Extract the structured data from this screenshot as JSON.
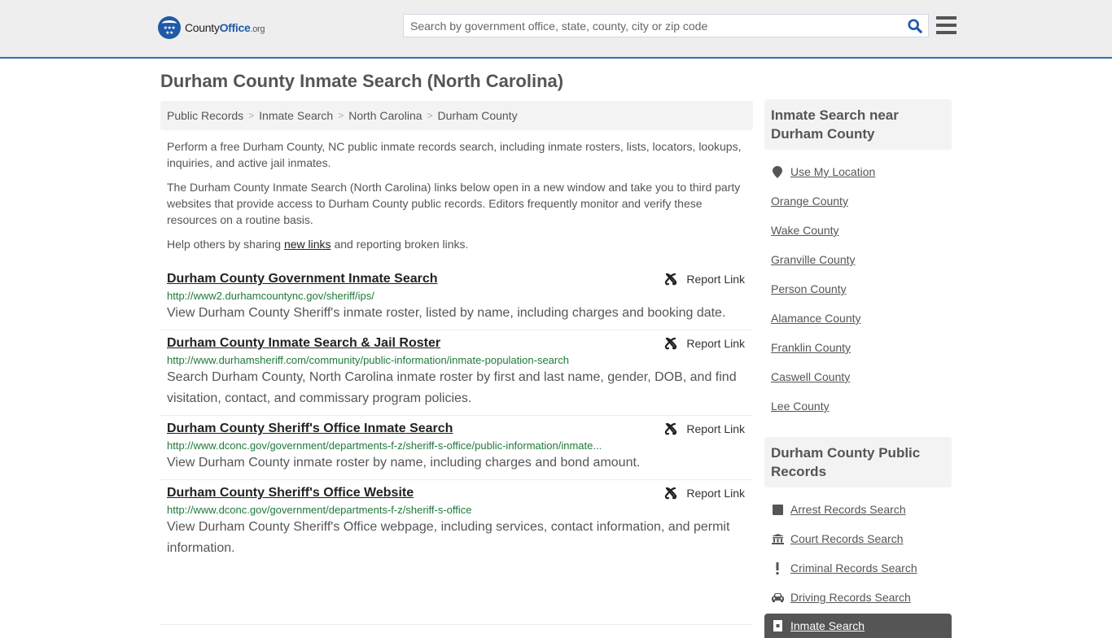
{
  "header": {
    "logo": {
      "part1": "County",
      "part2": "Office",
      "part3": ".org"
    },
    "search_placeholder": "Search by government office, state, county, city or zip code",
    "search_value": "",
    "brand_color": "#1f5aa6"
  },
  "page_title": "Durham County Inmate Search (North Carolina)",
  "breadcrumb": [
    "Public Records",
    "Inmate Search",
    "North Carolina",
    "Durham County"
  ],
  "intro": {
    "p1": "Perform a free Durham County, NC public inmate records search, including inmate rosters, lists, locators, lookups, inquiries, and active jail inmates.",
    "p2": "The Durham County Inmate Search (North Carolina) links below open in a new window and take you to third party websites that provide access to Durham County public records. Editors frequently monitor and verify these resources on a routine basis.",
    "p3_before": "Help others by sharing ",
    "p3_link": "new links",
    "p3_after": " and reporting broken links."
  },
  "report_label": "Report Link",
  "results": [
    {
      "title": "Durham County Government Inmate Search",
      "url": "http://www2.durhamcountync.gov/sheriff/ips/",
      "desc": "View Durham County Sheriff's inmate roster, listed by name, including charges and booking date."
    },
    {
      "title": "Durham County Inmate Search & Jail Roster",
      "url": "http://www.durhamsheriff.com/community/public-information/inmate-population-search",
      "desc": "Search Durham County, North Carolina inmate roster by first and last name, gender, DOB, and find visitation, contact, and commissary program policies."
    },
    {
      "title": "Durham County Sheriff's Office Inmate Search",
      "url": "http://www.dconc.gov/government/departments-f-z/sheriff-s-office/public-information/inmate...",
      "desc": "View Durham County inmate roster by name, including charges and bond amount."
    },
    {
      "title": "Durham County Sheriff's Office Website",
      "url": "http://www.dconc.gov/government/departments-f-z/sheriff-s-office",
      "desc": "View Durham County Sheriff's Office webpage, including services, contact information, and permit information."
    }
  ],
  "sidebar": {
    "nearby_heading": "Inmate Search near Durham County",
    "use_location": "Use My Location",
    "nearby": [
      "Orange County",
      "Wake County",
      "Granville County",
      "Person County",
      "Alamance County",
      "Franklin County",
      "Caswell County",
      "Lee County"
    ],
    "records_heading": "Durham County Public Records",
    "records": [
      {
        "label": "Arrest Records Search",
        "icon": "arrest-icon"
      },
      {
        "label": "Court Records Search",
        "icon": "courthouse-icon"
      },
      {
        "label": "Criminal Records Search",
        "icon": "exclamation-icon"
      },
      {
        "label": "Driving Records Search",
        "icon": "car-icon"
      }
    ],
    "active_item": "Inmate Search"
  }
}
